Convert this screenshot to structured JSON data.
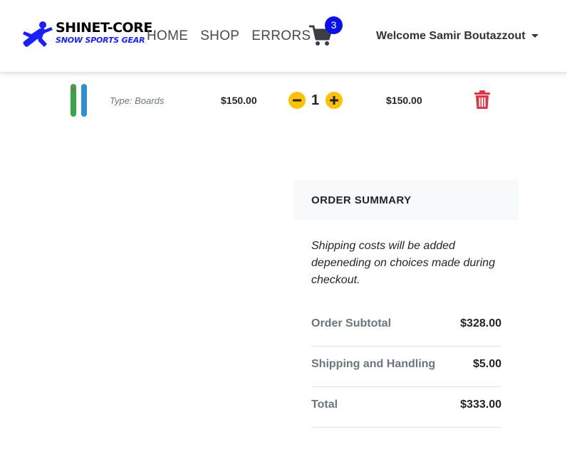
{
  "brand": {
    "title": "SHINET-CORE",
    "subtitle": "SNOW SPORTS GEAR",
    "icon": "snowboarder-icon"
  },
  "nav": {
    "links": [
      "HOME",
      "SHOP",
      "ERRORS"
    ],
    "cart_count": "3",
    "cart_icon": "shopping-cart-icon",
    "welcome": "Welcome Samir Boutazzout"
  },
  "cart": {
    "items": [
      {
        "type": "Type: Boards",
        "price": "$150.00",
        "quantity": "1",
        "total": "$150.00",
        "image": "snowboard-icon"
      }
    ]
  },
  "summary": {
    "title": "ORDER SUMMARY",
    "note": "Shipping costs will be added depeneding on choices made during checkout.",
    "rows": [
      {
        "label": "Order Subtotal",
        "value": "$328.00"
      },
      {
        "label": "Shipping and Handling",
        "value": "$5.00"
      },
      {
        "label": "Total",
        "value": "$333.00"
      }
    ]
  },
  "colors": {
    "badge": "#0a10e8",
    "qty_buttons": "#ffc107",
    "trash": "#dc3545",
    "brand_blue": "#1a20ff"
  }
}
